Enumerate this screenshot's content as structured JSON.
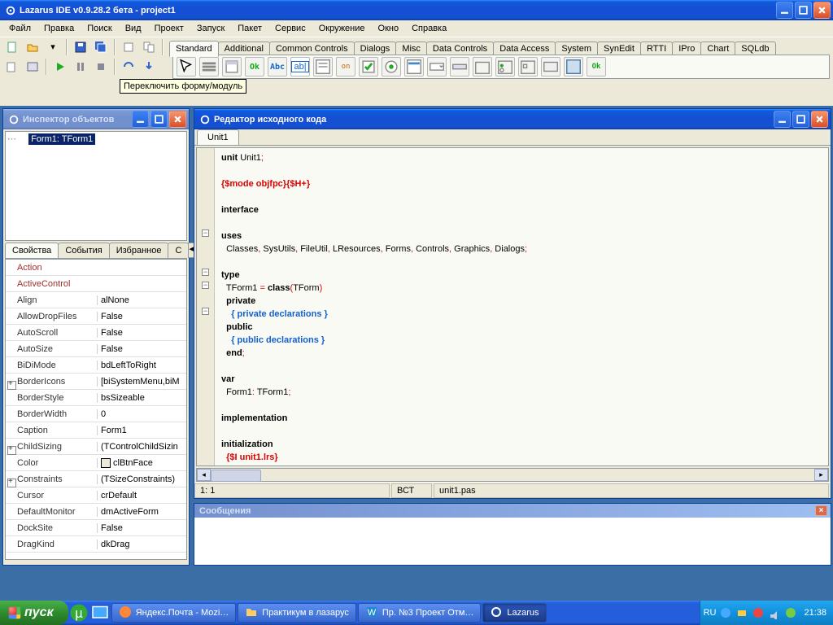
{
  "main": {
    "title": "Lazarus IDE v0.9.28.2 бета - project1",
    "menu": [
      "Файл",
      "Правка",
      "Поиск",
      "Вид",
      "Проект",
      "Запуск",
      "Пакет",
      "Сервис",
      "Окружение",
      "Окно",
      "Справка"
    ],
    "component_tabs": [
      "Standard",
      "Additional",
      "Common Controls",
      "Dialogs",
      "Misc",
      "Data Controls",
      "Data Access",
      "System",
      "SynEdit",
      "RTTI",
      "IPro",
      "Chart",
      "SQLdb"
    ],
    "active_component_tab": "Standard",
    "tooltip": "Переключить форму/модуль"
  },
  "inspector": {
    "title": "Инспектор объектов",
    "tree_item": "Form1: TForm1",
    "tabs": [
      "Свойства",
      "События",
      "Избранное"
    ],
    "tabs_extra": "С",
    "active_tab": "Свойства",
    "props": [
      {
        "n": "Action",
        "v": "",
        "red": true
      },
      {
        "n": "ActiveControl",
        "v": "",
        "red": true
      },
      {
        "n": "Align",
        "v": "alNone"
      },
      {
        "n": "AllowDropFiles",
        "v": "False"
      },
      {
        "n": "AutoScroll",
        "v": "False"
      },
      {
        "n": "AutoSize",
        "v": "False"
      },
      {
        "n": "BiDiMode",
        "v": "bdLeftToRight"
      },
      {
        "n": "BorderIcons",
        "v": "[biSystemMenu,biM",
        "ex": true
      },
      {
        "n": "BorderStyle",
        "v": "bsSizeable"
      },
      {
        "n": "BorderWidth",
        "v": "0"
      },
      {
        "n": "Caption",
        "v": "Form1"
      },
      {
        "n": "ChildSizing",
        "v": "(TControlChildSizin",
        "ex": true
      },
      {
        "n": "Color",
        "v": "clBtnFace",
        "swatch": true
      },
      {
        "n": "Constraints",
        "v": "(TSizeConstraints)",
        "ex": true
      },
      {
        "n": "Cursor",
        "v": "crDefault"
      },
      {
        "n": "DefaultMonitor",
        "v": "dmActiveForm"
      },
      {
        "n": "DockSite",
        "v": "False"
      },
      {
        "n": "DragKind",
        "v": "dkDrag"
      }
    ]
  },
  "editor": {
    "title": "Редактор исходного кода",
    "file_tab": "Unit1",
    "status_pos": "1: 1",
    "status_mode": "ВСТ",
    "status_file": "unit1.pas",
    "code": {
      "l1a": "unit",
      "l1b": " Unit1",
      "l1c": ";",
      "l2": "{$mode objfpc}{$H+}",
      "l3": "interface",
      "l4": "uses",
      "l5a": "  Classes",
      "c": ",",
      "l5b": " SysUtils",
      "l5c": " FileUtil",
      "l5d": " LResources",
      "l5e": " Forms",
      "l5f": " Controls",
      "l5g": " Graphics",
      "l5h": " Dialogs",
      "sc": ";",
      "l6": "type",
      "l7a": "  TForm1 ",
      "l7b": "=",
      "l7c": " class",
      "l7d": "(",
      "l7e": "TForm",
      "l7f": ")",
      "l8": "  private",
      "l9": "    { private declarations }",
      "l10": "  public",
      "l11": "    { public declarations }",
      "l12a": "  end",
      "l12b": ";",
      "l13": "var",
      "l14a": "  Form1",
      "l14b": ":",
      "l14c": " TForm1",
      "l14d": ";",
      "l15": "implementation",
      "l16": "initialization",
      "l17": "  {$I unit1.lrs}"
    }
  },
  "messages": {
    "title": "Сообщения"
  },
  "taskbar": {
    "start": "пуск",
    "tasks": [
      {
        "label": "Яндекс.Почта - Mozi…",
        "icon": "ff"
      },
      {
        "label": "Практикум в лазарус",
        "icon": "folder"
      },
      {
        "label": "Пр. №3 Проект Отм…",
        "icon": "word"
      },
      {
        "label": "Lazarus",
        "icon": "gear",
        "active": true
      }
    ],
    "lang": "RU",
    "clock": "21:38"
  }
}
